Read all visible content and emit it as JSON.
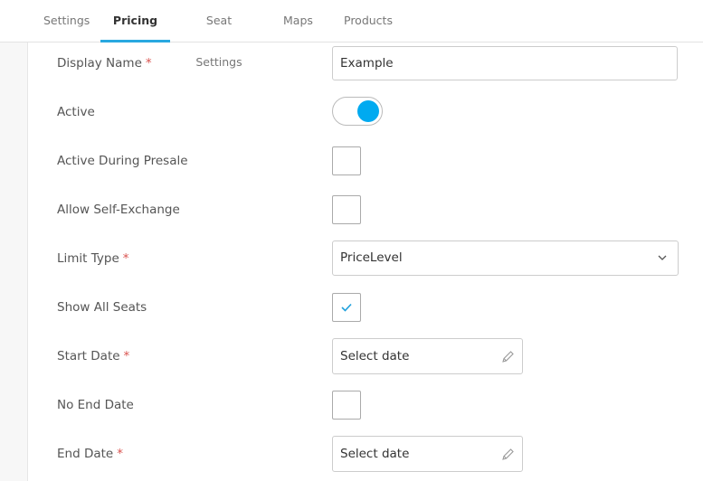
{
  "tabs": [
    {
      "label": "Settings",
      "active": false
    },
    {
      "label": "Pricing",
      "active": true
    },
    {
      "label": "Seat Settings",
      "active": false
    },
    {
      "label": "Maps",
      "active": false
    },
    {
      "label": "Products",
      "active": false
    }
  ],
  "colors": {
    "accent": "#29a8e0",
    "toggle_on": "#00aaf0",
    "required": "#d9534f"
  },
  "form": {
    "display_name": {
      "label": "Display Name",
      "required_mark": "*",
      "value": "Example"
    },
    "active": {
      "label": "Active",
      "checked": true
    },
    "active_during_presale": {
      "label": "Active During Presale",
      "checked": false
    },
    "allow_self_exchange": {
      "label": "Allow Self-Exchange",
      "checked": false
    },
    "limit_type": {
      "label": "Limit Type",
      "required_mark": "*",
      "value": "PriceLevel",
      "icon": "chevron-down-icon"
    },
    "show_all_seats": {
      "label": "Show All Seats",
      "checked": true,
      "icon": "checkmark-icon"
    },
    "start_date": {
      "label": "Start Date",
      "required_mark": "*",
      "placeholder": "Select date",
      "icon": "pencil-icon"
    },
    "no_end_date": {
      "label": "No End Date",
      "checked": false
    },
    "end_date": {
      "label": "End Date",
      "required_mark": "*",
      "placeholder": "Select date",
      "icon": "pencil-icon"
    }
  }
}
